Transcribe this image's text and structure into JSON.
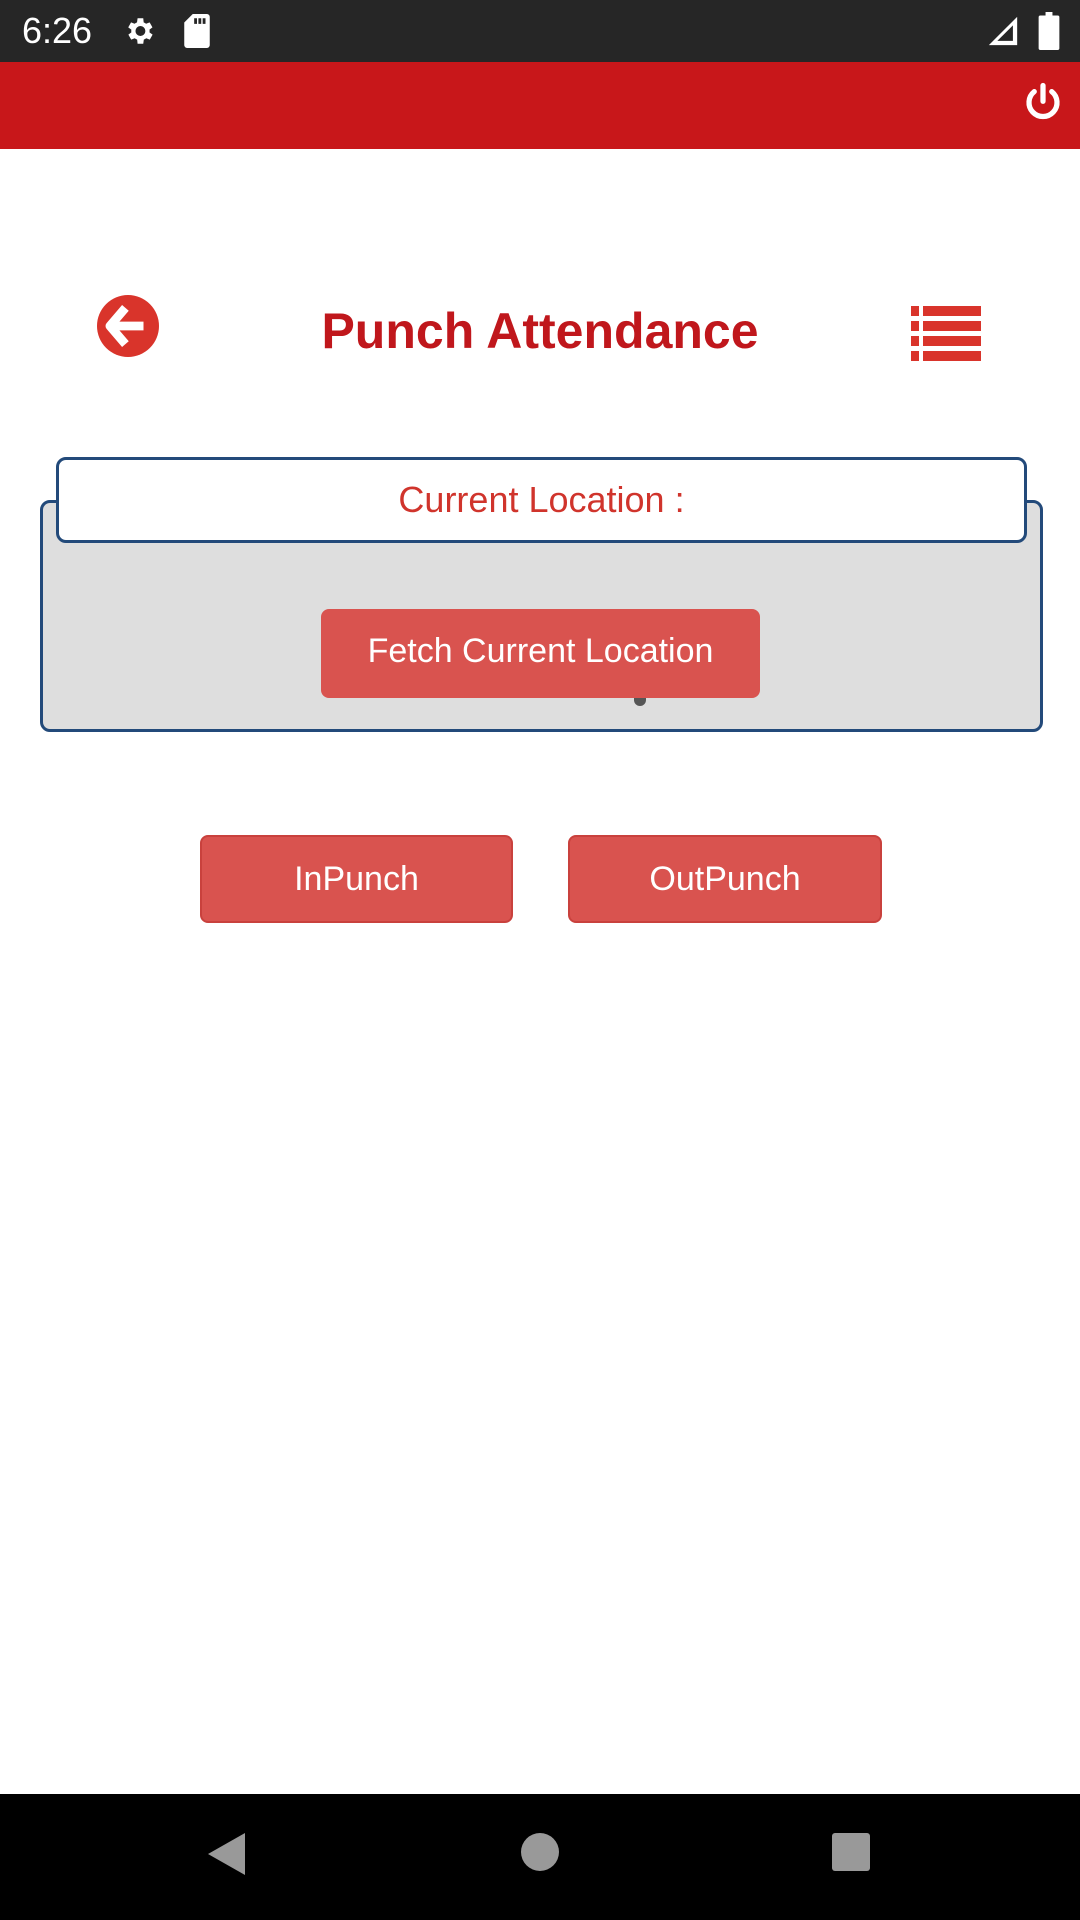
{
  "status_bar": {
    "time": "6:26",
    "icons": [
      "gear-icon",
      "sd-card-icon",
      "signal-icon",
      "battery-icon"
    ]
  },
  "app_bar": {
    "power_icon": "power-icon",
    "color": "#c8171a"
  },
  "header": {
    "title": "Punch Attendance",
    "back_icon": "arrow-left-circle-icon",
    "list_icon": "list-icon"
  },
  "location": {
    "label": "Current Location :",
    "fetch_button": "Fetch Current Location"
  },
  "actions": {
    "in_punch": "InPunch",
    "out_punch": "OutPunch"
  },
  "nav_bar": {
    "icons": [
      "back-icon",
      "home-icon",
      "recents-icon"
    ]
  }
}
